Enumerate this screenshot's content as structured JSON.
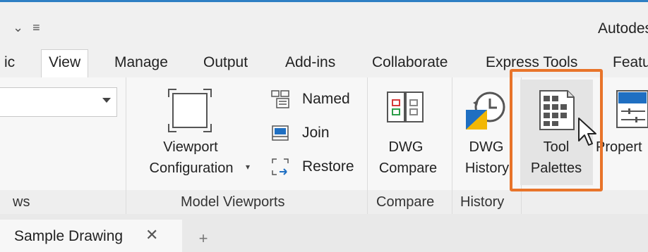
{
  "window": {
    "qat_chevron": "⌄",
    "qat_menu": "≡",
    "app_title": "Autodesk"
  },
  "tabs": [
    {
      "label": "ic",
      "active": false
    },
    {
      "label": "View",
      "active": true
    },
    {
      "label": "Manage",
      "active": false
    },
    {
      "label": "Output",
      "active": false
    },
    {
      "label": "Add-ins",
      "active": false
    },
    {
      "label": "Collaborate",
      "active": false
    },
    {
      "label": "Express Tools",
      "active": false
    },
    {
      "label": "Featu",
      "active": false
    }
  ],
  "ribbon": {
    "views_panel": {
      "label": "ws",
      "combo_value": ""
    },
    "model_viewports": {
      "label": "Model Viewports",
      "viewport_config_line1": "Viewport",
      "viewport_config_line2": "Configuration",
      "named": "Named",
      "join": "Join",
      "restore": "Restore"
    },
    "compare": {
      "label": "Compare",
      "dwg_compare_line1": "DWG",
      "dwg_compare_line2": "Compare"
    },
    "history": {
      "label": "History",
      "dwg_history_line1": "DWG",
      "dwg_history_line2": "History"
    },
    "palettes": {
      "tool_palettes_line1": "Tool",
      "tool_palettes_line2": "Palettes",
      "properties": "Propert"
    }
  },
  "doc_tabs": {
    "active_tab": "Sample Drawing",
    "close_glyph": "✕",
    "new_tab_glyph": "+"
  },
  "colors": {
    "accent_blue": "#2e7fc4",
    "highlight_orange": "#e8742a",
    "icon_blue": "#1f6fc2",
    "icon_yellow": "#f2b705"
  }
}
